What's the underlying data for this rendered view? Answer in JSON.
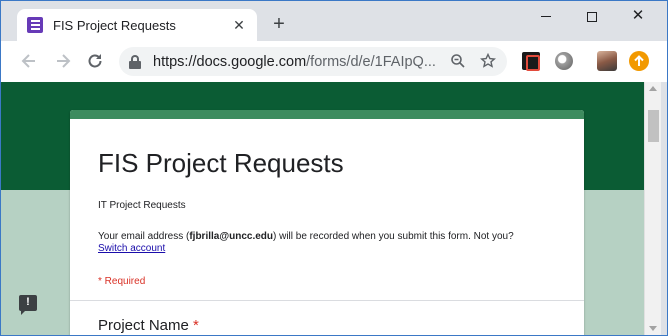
{
  "browser": {
    "tab_title": "FIS Project Requests",
    "tab_close": "✕",
    "new_tab": "+",
    "url_host": "https://docs.google.com",
    "url_path": "/forms/d/e/1FAIpQ...",
    "window_controls": {
      "minimize": "",
      "maximize": "",
      "close": "✕"
    },
    "icons": {
      "back": "arrow-left-icon",
      "forward": "arrow-right-icon",
      "reload": "reload-icon",
      "zoom": "zoom-out-icon",
      "bookmark": "star-icon",
      "pdf": "adobe-pdf-icon",
      "extension": "extension-icon",
      "profile": "avatar",
      "update": "update-arrow-icon"
    }
  },
  "form": {
    "title": "FIS Project Requests",
    "description": "IT Project Requests",
    "email_prefix": "Your email address (",
    "email": "fjbrilla@uncc.edu",
    "email_suffix": ") will be recorded when you submit this form. Not you?",
    "switch_account": "Switch account",
    "required_note": "* Required",
    "first_question": "Project Name",
    "required_marker": "*"
  },
  "colors": {
    "banner": "#0b5c34",
    "background": "#b6d1c3",
    "accent": "#3d8c5f",
    "required": "#d93025"
  }
}
